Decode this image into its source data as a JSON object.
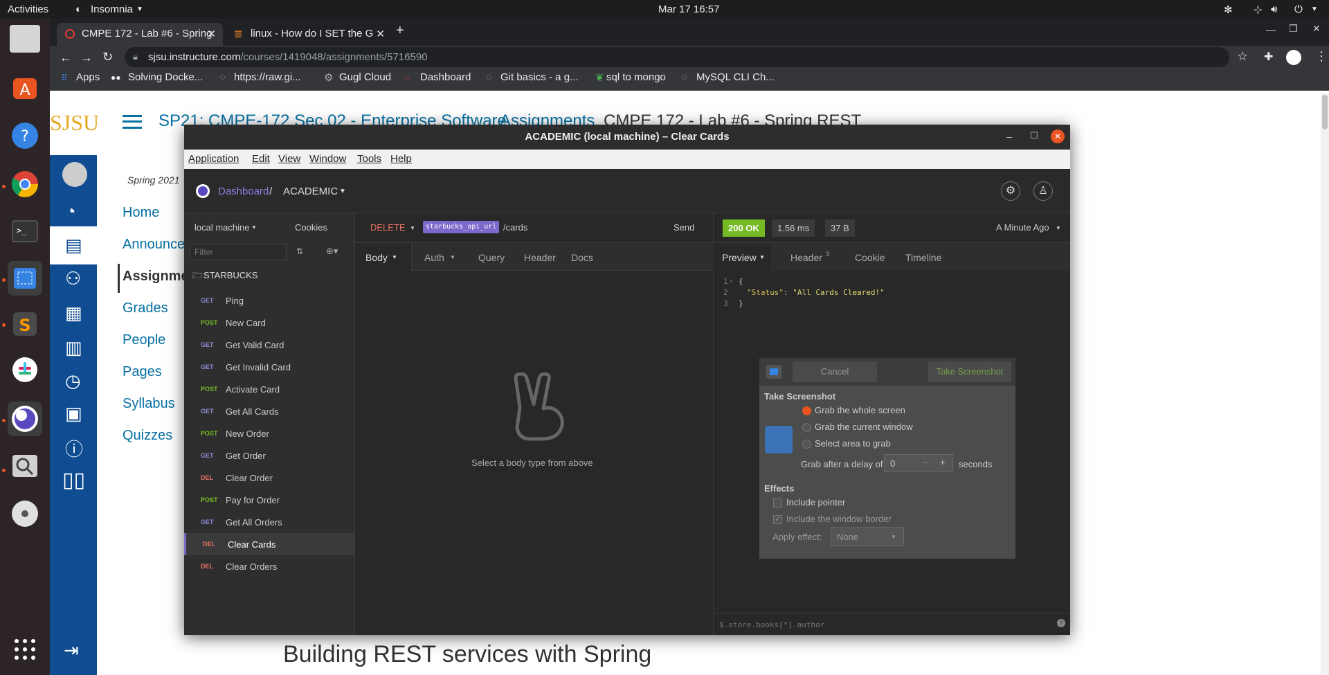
{
  "topbar": {
    "activities": "Activities",
    "app": "Insomnia",
    "datetime": "Mar 17  16:57"
  },
  "chrome": {
    "tabs": [
      {
        "title": "CMPE 172 - Lab #6 - Spring"
      },
      {
        "title": "linux - How do I SET the G"
      }
    ],
    "url_host": "sjsu.instructure.com",
    "url_path": "/courses/1419048/assignments/5716590",
    "bookmarks": [
      "Apps",
      "Solving Docke...",
      "https://raw.gi...",
      "Gugl Cloud",
      "Dashboard",
      "Git basics - a g...",
      "sql to mongo",
      "MySQL CLI Ch..."
    ]
  },
  "canvas": {
    "logo": "SJSU",
    "breadcrumb": [
      "SP21: CMPE-172 Sec 02 - Enterprise Software",
      "Assignments",
      "CMPE 172 - Lab #6 - Spring REST"
    ],
    "term": "Spring 2021",
    "course_nav": [
      "Home",
      "Announcements",
      "Assignments",
      "Grades",
      "People",
      "Pages",
      "Syllabus",
      "Quizzes"
    ],
    "heading": "Building REST services with Spring"
  },
  "insomnia": {
    "window_title": "ACADEMIC (local machine) – Clear Cards",
    "menu": [
      "Application",
      "Edit",
      "View",
      "Window",
      "Tools",
      "Help"
    ],
    "breadcrumb_dashboard": "Dashboard",
    "breadcrumb_sep": " / ",
    "workspace": "ACADEMIC",
    "environment": "local machine",
    "cookies": "Cookies",
    "filter_placeholder": "Filter",
    "folder": "STARBUCKS",
    "requests": [
      {
        "method": "GET",
        "name": "Ping"
      },
      {
        "method": "POST",
        "name": "New Card"
      },
      {
        "method": "GET",
        "name": "Get Valid Card"
      },
      {
        "method": "GET",
        "name": "Get Invalid Card"
      },
      {
        "method": "POST",
        "name": "Activate Card"
      },
      {
        "method": "GET",
        "name": "Get All Cards"
      },
      {
        "method": "POST",
        "name": "New Order"
      },
      {
        "method": "GET",
        "name": "Get Order"
      },
      {
        "method": "DEL",
        "name": "Clear Order"
      },
      {
        "method": "POST",
        "name": "Pay for Order"
      },
      {
        "method": "GET",
        "name": "Get All Orders"
      },
      {
        "method": "DEL",
        "name": "Clear Cards"
      },
      {
        "method": "DEL",
        "name": "Clear Orders"
      }
    ],
    "active_request": "Clear Cards",
    "request": {
      "method": "DELETE",
      "url_var": "starbucks_api_url",
      "url_path": "/cards",
      "send": "Send",
      "tabs": [
        "Body",
        "Auth",
        "Query",
        "Header",
        "Docs"
      ],
      "empty_body": "Select a body type from above"
    },
    "response": {
      "status": "200 OK",
      "time": "1.56 ms",
      "size": "37 B",
      "when": "A Minute Ago",
      "tabs": [
        "Preview",
        "Header",
        "Cookie",
        "Timeline"
      ],
      "header_count": "3",
      "lines": [
        "1",
        "2",
        "3"
      ],
      "json_open": "{",
      "json_key": "\"Status\"",
      "json_colon": ": ",
      "json_value": "\"All Cards Cleared!\"",
      "json_close": "}",
      "filter_placeholder": "$.store.books[*].author"
    }
  },
  "screenshot_dialog": {
    "cancel": "Cancel",
    "take": "Take Screenshot",
    "section": "Take Screenshot",
    "options": [
      "Grab the whole screen",
      "Grab the current window",
      "Select area to grab"
    ],
    "selected_option": 0,
    "delay_label": "Grab after a delay of",
    "delay_value": "0",
    "delay_unit": "seconds",
    "effects": "Effects",
    "include_pointer": "Include pointer",
    "include_border": "Include the window border",
    "apply_effect": "Apply effect:",
    "effect_value": "None"
  },
  "colors": {
    "get": "#8b8bd6",
    "post": "#75ba24",
    "del": "#ec7263",
    "ok": "#75ba24",
    "accent": "#7d69cb",
    "canvas_nav": "#0f4c91"
  }
}
